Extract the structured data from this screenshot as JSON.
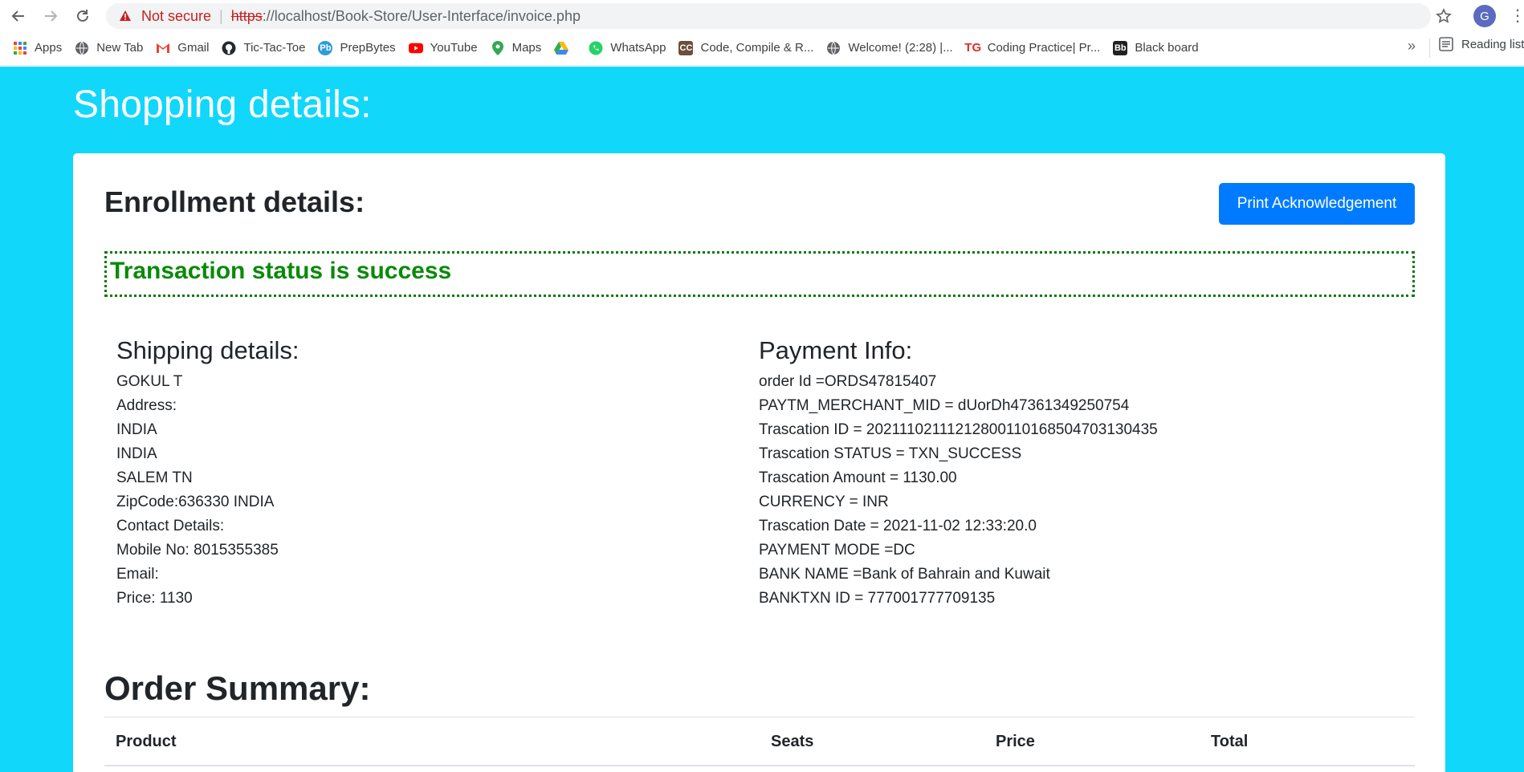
{
  "browser": {
    "not_secure": "Not secure",
    "url_scheme": "https",
    "url_rest": "://localhost/Book-Store/User-Interface/invoice.php",
    "avatar_letter": "G",
    "bookmarks": [
      {
        "label": "Apps",
        "icon": "apps-grid-icon",
        "color": "#4285f4"
      },
      {
        "label": "New Tab",
        "icon": "globe-icon",
        "color": "#5f6368"
      },
      {
        "label": "Gmail",
        "icon": "gmail-icon",
        "color": "#ea4335"
      },
      {
        "label": "Tic-Tac-Toe",
        "icon": "github-icon",
        "color": "#24292e"
      },
      {
        "label": "PrepBytes",
        "icon": "prepbytes-icon",
        "color": "#2d9cdb"
      },
      {
        "label": "YouTube",
        "icon": "youtube-icon",
        "color": "#ff0000"
      },
      {
        "label": "Maps",
        "icon": "maps-pin-icon",
        "color": "#34a853"
      },
      {
        "label": "",
        "icon": "google-drive-icon",
        "color": "#fbbc04"
      },
      {
        "label": "WhatsApp",
        "icon": "whatsapp-icon",
        "color": "#25d366"
      },
      {
        "label": "Code, Compile & R...",
        "icon": "codechef-icon",
        "color": "#6b4f3a"
      },
      {
        "label": "Welcome! (2:28) |...",
        "icon": "globe-icon",
        "color": "#5f6368"
      },
      {
        "label": "Coding Practice| Pr...",
        "icon": "tg-icon",
        "color": "#d93025"
      },
      {
        "label": "Black board",
        "icon": "blackboard-icon",
        "color": "#222222"
      }
    ],
    "more": "»",
    "reading_list": "Reading list"
  },
  "page": {
    "title": "Shopping details:",
    "enroll_heading": "Enrollment details:",
    "print_button": "Print Acknowledgement",
    "status": "Transaction status is success",
    "shipping": {
      "heading": "Shipping details:",
      "lines": [
        "GOKUL T",
        "Address:",
        "INDIA",
        "INDIA",
        "SALEM TN",
        "ZipCode:636330 INDIA",
        "Contact Details:",
        "Mobile No: 8015355385",
        "Email:",
        "Price: 1130"
      ]
    },
    "payment": {
      "heading": "Payment Info:",
      "lines": [
        "order Id =ORDS47815407",
        "PAYTM_MERCHANT_MID = dUorDh47361349250754",
        "Trascation ID = 20211102111212800110168504703130435",
        "Trascation STATUS = TXN_SUCCESS",
        "Trascation Amount = 1130.00",
        "CURRENCY = INR",
        "Trascation Date = 2021-11-02 12:33:20.0",
        "PAYMENT MODE =DC",
        "BANK NAME =Bank of Bahrain and Kuwait",
        "BANKTXN ID = 777001777709135"
      ]
    },
    "order_summary": "Order Summary:",
    "table_headers": [
      "Product",
      "Seats",
      "Price",
      "Total"
    ]
  }
}
